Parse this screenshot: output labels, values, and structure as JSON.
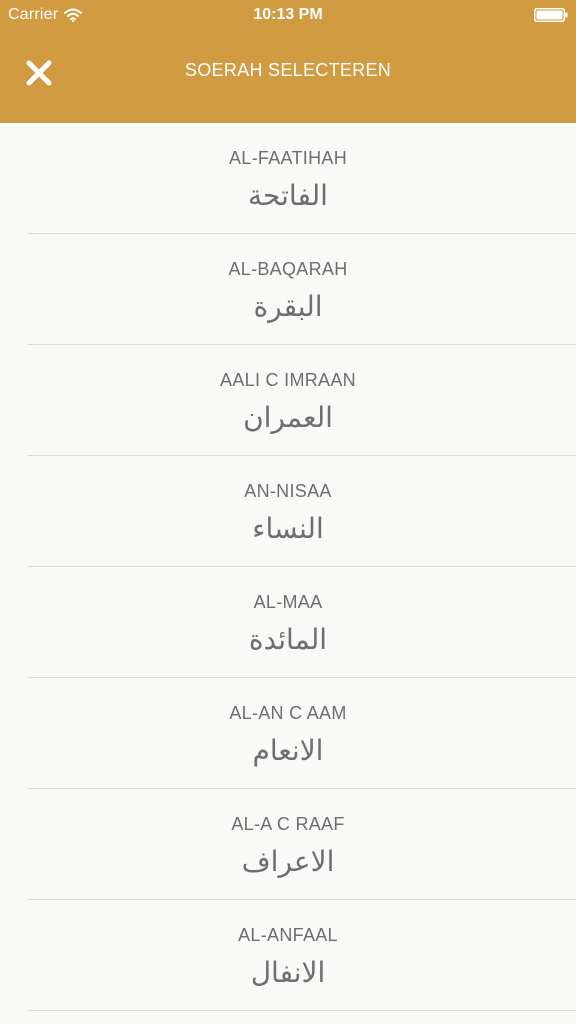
{
  "status_bar": {
    "carrier": "Carrier",
    "time": "10:13 PM",
    "wifi_icon": "wifi-icon",
    "battery_icon": "battery-icon"
  },
  "nav": {
    "title": "SOERAH SELECTEREN",
    "close_icon": "close-icon"
  },
  "colors": {
    "header": "#d19b42",
    "background": "#f9f9f7",
    "text": "#6e6e6e",
    "divider": "#dcdcd8"
  },
  "surahs": [
    {
      "latin": "AL-FAATIHAH",
      "arabic": "الفاتحة"
    },
    {
      "latin": "AL-BAQARAH",
      "arabic": "البقرة"
    },
    {
      "latin": "AALI C IMRAAN",
      "arabic": "العمران"
    },
    {
      "latin": "AN-NISAA",
      "arabic": "النساء"
    },
    {
      "latin": "AL-MAA",
      "arabic": "المائدة"
    },
    {
      "latin": "AL-AN C AAM",
      "arabic": "الانعام"
    },
    {
      "latin": "AL-A C RAAF",
      "arabic": "الاعراف"
    },
    {
      "latin": "AL-ANFAAL",
      "arabic": "الانفال"
    }
  ]
}
